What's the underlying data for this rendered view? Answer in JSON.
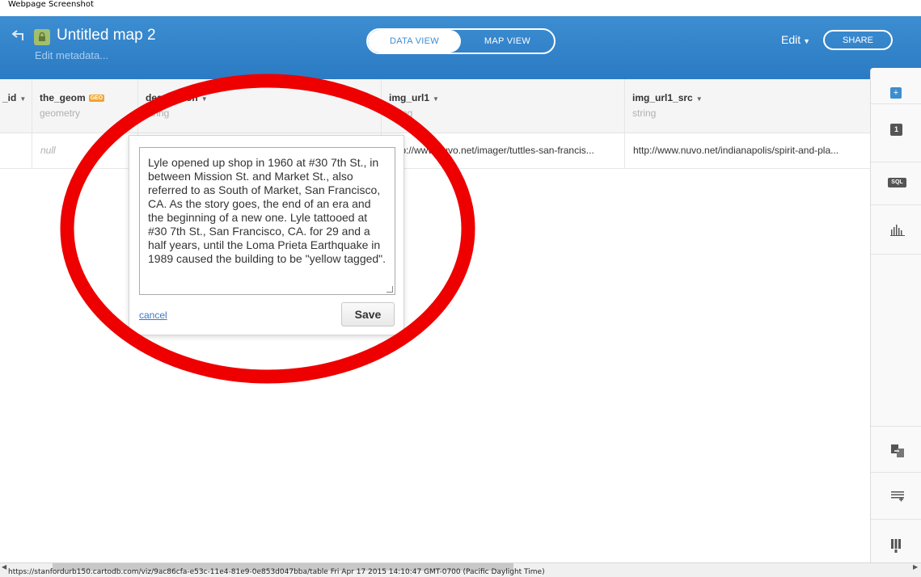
{
  "caption": "Webpage Screenshot",
  "header": {
    "title": "Untitled map 2",
    "edit_metadata": "Edit metadata...",
    "tabs": [
      {
        "label": "DATA VIEW"
      },
      {
        "label": "MAP VIEW"
      }
    ],
    "edit_label": "Edit",
    "share_label": "SHARE"
  },
  "columns": [
    {
      "name": "_id",
      "type": ""
    },
    {
      "name": "the_geom",
      "badge": "GEO",
      "type": "geometry"
    },
    {
      "name": "description",
      "type": "string"
    },
    {
      "name": "img_url1",
      "type": "string"
    },
    {
      "name": "img_url1_src",
      "type": "string"
    }
  ],
  "row": {
    "the_geom": "null",
    "img_url1": "http://www.nuvo.net/imager/tuttles-san-francis...",
    "img_url1_src": "http://www.nuvo.net/indianapolis/spirit-and-pla..."
  },
  "editor": {
    "text": "Lyle opened up shop in 1960 at #30 7th St., in between Mission St. and Market St., also referred to as South of Market, San Francisco, CA. As the story goes, the end of an era and the beginning of a new one. Lyle tattooed at #30 7th St., San Francisco, CA. for 29 and a half years, until the Loma Prieta Earthquake in 1989 caused the building to be \"yellow tagged\".",
    "cancel_label": "cancel",
    "save_label": "Save"
  },
  "sidebar": {
    "items": [
      {
        "icon": "add-layer-icon",
        "label": "+"
      },
      {
        "icon": "layer-number-icon",
        "label": "1"
      },
      {
        "icon": "sql-icon",
        "label": "SQL"
      },
      {
        "icon": "bar-chart-icon"
      },
      {
        "icon": "merge-icon"
      },
      {
        "icon": "add-row-icon"
      },
      {
        "icon": "add-column-icon"
      }
    ]
  },
  "status": {
    "text": "https://stanfordurb150.cartodb.com/viz/9ac86cfa-e53c-11e4-81e9-0e853d047bba/table Fri Apr 17 2015 14:10:47 GMT-0700 (Pacific Daylight Time)"
  },
  "colors": {
    "header_blue": "#2b7bc4",
    "annotation_red": "#ee0000",
    "geo_badge": "#f1a42b"
  }
}
